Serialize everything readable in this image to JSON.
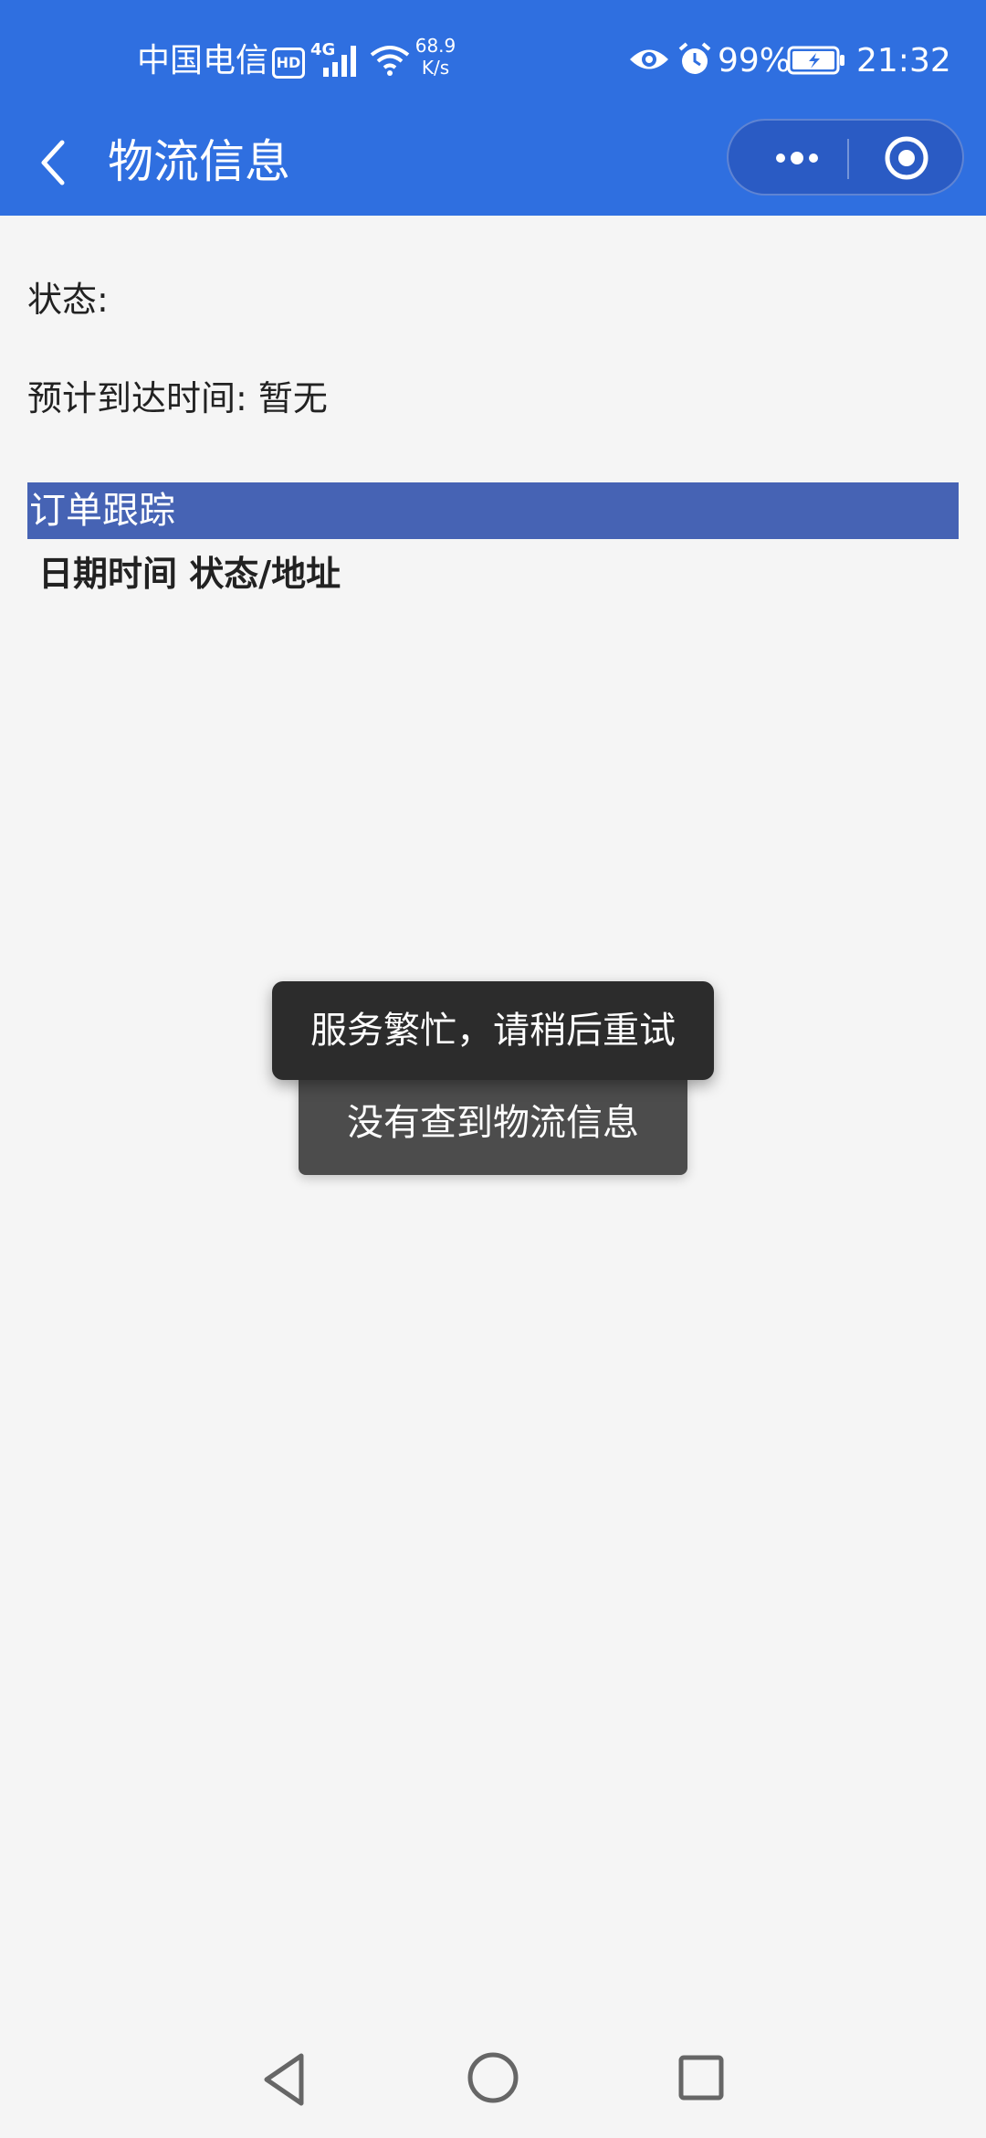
{
  "status_bar": {
    "carrier": "中国电信",
    "hd_badge": "HD",
    "network_type": "4G",
    "speed_value": "68.9",
    "speed_unit": "K/s",
    "battery_percent": "99%",
    "time": "21:32",
    "icons": [
      "hd-icon",
      "signal-icon",
      "wifi-icon",
      "eye-icon",
      "alarm-icon",
      "battery-charging-icon"
    ]
  },
  "navbar": {
    "title": "物流信息",
    "back_icon": "chevron-left-icon",
    "more_icon": "more-dots-icon",
    "close_icon": "target-close-icon"
  },
  "content": {
    "status_label": "状态:",
    "eta_label": "预计到达时间:  暂无",
    "section_title": "订单跟踪",
    "table_header": "日期时间 状态/地址"
  },
  "toasts": {
    "primary": "服务繁忙，请稍后重试",
    "secondary": "没有查到物流信息"
  },
  "system_nav": {
    "back_icon": "triangle-back-icon",
    "home_icon": "circle-home-icon",
    "recent_icon": "square-recent-icon"
  },
  "colors": {
    "header": "#2f6fe0",
    "section_bar": "#4663b4",
    "background": "#f5f5f5",
    "toast_primary": "#2c2c2c",
    "toast_secondary": "#4c4c4c"
  }
}
